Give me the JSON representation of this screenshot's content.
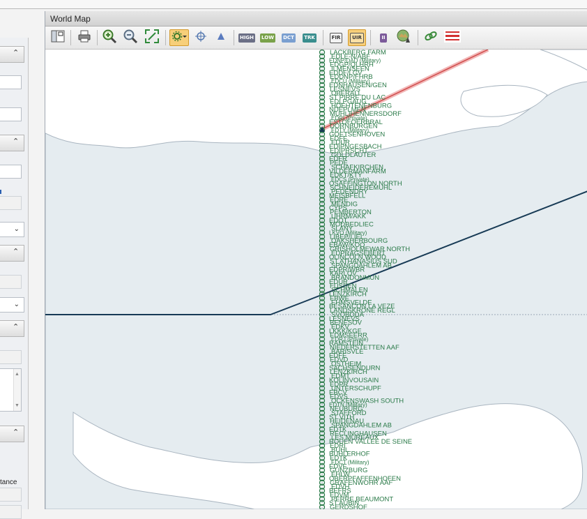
{
  "window": {
    "title": "World Map"
  },
  "left_panel": {
    "partial_label": "tance"
  },
  "toolbar": {
    "buttons": [
      {
        "name": "map-layout-button",
        "icon": "layout-icon"
      },
      {
        "name": "print-button",
        "icon": "printer-icon"
      },
      {
        "name": "zoom-in-button",
        "icon": "zoom-in-icon"
      },
      {
        "name": "zoom-out-button",
        "icon": "zoom-out-icon"
      },
      {
        "name": "fit-extent-button",
        "icon": "fit-icon"
      },
      {
        "name": "airport-filter-button",
        "icon": "airport-gear-icon",
        "active": true
      },
      {
        "name": "navaid-filter-button",
        "icon": "crosshair-icon"
      },
      {
        "name": "waypoint-filter-button",
        "icon": "triangle-icon"
      }
    ],
    "badges": {
      "high": "HIGH",
      "low": "LOW",
      "dct": "DCT",
      "trk": "TRK",
      "fir": "FIR",
      "uir": "UIR",
      "roman": "II"
    },
    "badge_colors": {
      "high": "#6b6f86",
      "low": "#7aa24a",
      "dct": "#7a9fd0",
      "trk": "#3a8e8e"
    },
    "accent": "#f7cf7a"
  },
  "map": {
    "land_color": "#e5ecf0",
    "route_color": "#173a55",
    "pink_route_color": "#d04c4c",
    "label_color": "#2a7a48",
    "airport_labels": [
      "LACKBERG FARM",
      "EDLE-N/ABF",
      "EDNP/DAD (Military)",
      "EDGP/QLHRH",
      "ILMENSEEN",
      "EDDF/LGV",
      "EDDNP/FHRB",
      "EDCU (Military)",
      "EDNHAUSEN/GEN",
      "LESNEVS",
      "OBERALL",
      "ST PIRRE DU LAC",
      "EDLPGAUG",
      "HOEHTENENBURG",
      "NDEPLMEN",
      "MUHLIHENNERSDORF",
      "EDRI (Private)",
      "ESTOFOERBRAL",
      "DORNBURGEN",
      "EDTY (Military)",
      "GOETSENHOVEN",
      "EDFE",
      "EDUR",
      "EDIPNGESBACH",
      "EDIPRSCHT",
      "GOLDLAUTER",
      "EDFR",
      "PEDE",
      "SCHAFKIRCHEN",
      "VILDERMANFARM",
      "EDKT/KTY",
      "EDCS (Private)",
      "OSAFFINGTON NORTH",
      "SCHNEIDEREMUHL",
      "PEDENDRY",
      "MEISBFELL",
      "EDRE",
      "MENDIG",
      "CYPS",
      "PEMBERTON",
      "UHRM/AKK",
      "EDQT",
      "MODBEDLIEC",
      "SLANY",
      "LKVO (Military)",
      "LIBEP/LIEL",
      "OAKSHERBOURG",
      "EBAW/KOO",
      "GRISHOLMEWAR NORTH",
      "EDPRAGSEBERT",
      "OLINCOLN WOOD",
      "ST ATHANASIUS SUD",
      "SPANGDAHLEM AB",
      "EDPR/WBR",
      "KARLOV",
      "BRANDONMUN",
      "EDUR",
      "FUSSEN",
      "SCHMALEN",
      "LENZKIRCH",
      "EBWE",
      "EHMSVELDE",
      "BESANCON LA VEZE",
      "LANDSKRONE REGL",
      "SVOBODA",
      "LESNEVS",
      "BENESOV",
      "EDKV",
      "LKKK/KGF",
      "EDMSEERR",
      "EDRJ (Private)",
      "RAMSTEIN",
      "NIEDERSTETTEN AAF",
      "BARISVLE",
      "EDFE",
      "EDVD",
      "OSTHEIM",
      "SACHSENDURN",
      "LENZKIRCH",
      "EDMT",
      "KOLINVOUSAIN",
      "EDPR",
      "UNTERSCHUPF",
      "EBCV",
      "EDVS",
      "OCKENSWASH SOUTH",
      "EDTN (Military)",
      "NEUBURG",
      "STAFFORD",
      "ST VITH",
      "HEIDENAU",
      "SPANGDAHLEM AB",
      "EDTK",
      "RECLINGHAUSEN",
      "LES MUREAUX",
      "ROUEN VALLEE DE SEINE",
      "EDRI",
      "BUHL",
      "BUHLERHOF",
      "EDTK",
      "EDCT (Military)",
      "EDVE",
      "GUNZBURG",
      "EHLW",
      "OBERPFAFFENHOFEN",
      "GRAFENWOHR AAF",
      "EDVH",
      "BEFRS",
      "EDVM",
      "PERRE BEAUMONT",
      "ST AUBIN",
      "GERDSHOF"
    ]
  }
}
